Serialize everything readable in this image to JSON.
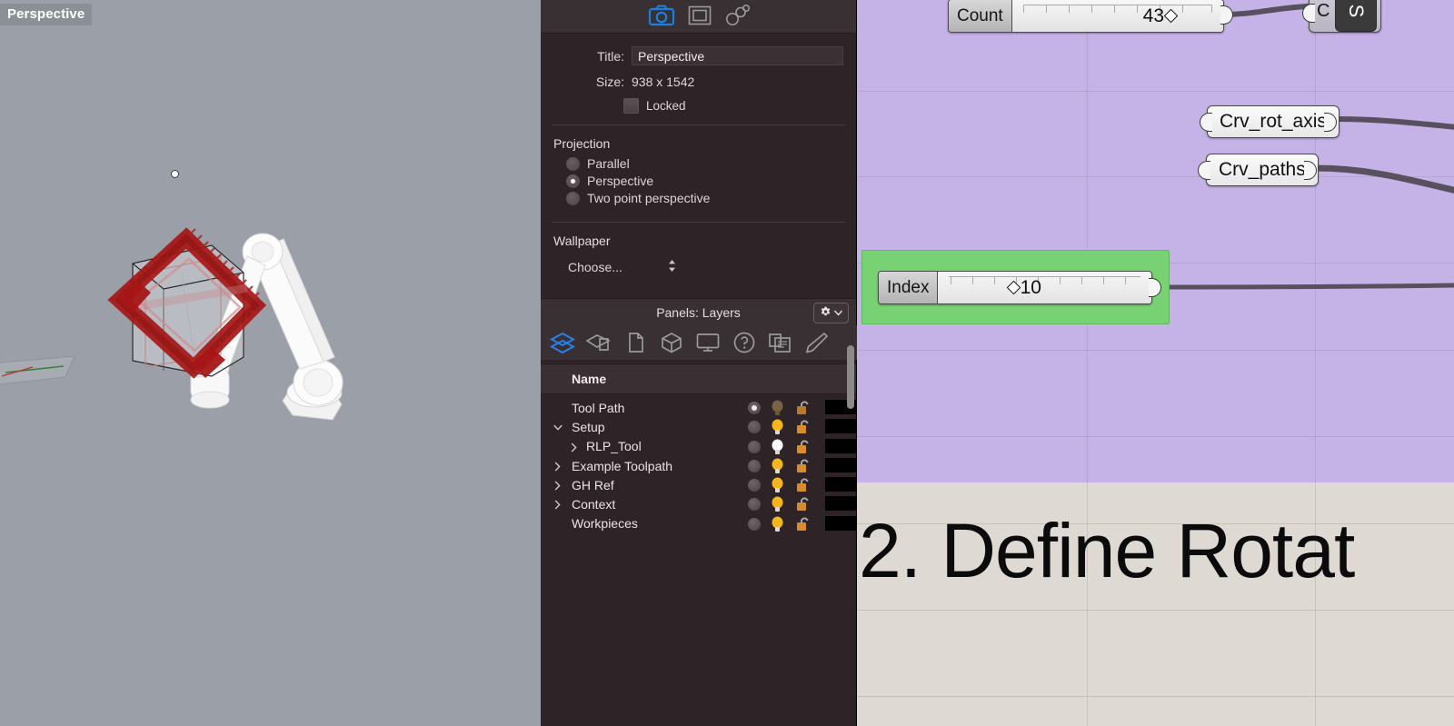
{
  "viewport": {
    "label": "Perspective",
    "background_color": "#9ba0a8",
    "scene_description": "White 6-axis robot arm with red toolpath curves around a transparent box workpiece"
  },
  "properties_panel": {
    "top_toolbar_icons": [
      "camera-icon",
      "viewport-frame-icon",
      "link-icon"
    ],
    "title_label": "Title:",
    "title_value": "Perspective",
    "size_label": "Size:",
    "size_value": "938 x 1542",
    "locked_label": "Locked",
    "locked_checked": false,
    "projection": {
      "heading": "Projection",
      "options": [
        {
          "label": "Parallel",
          "selected": false
        },
        {
          "label": "Perspective",
          "selected": true
        },
        {
          "label": "Two point perspective",
          "selected": false
        }
      ]
    },
    "wallpaper": {
      "heading": "Wallpaper",
      "choose_label": "Choose...",
      "stepper_icon": "chevron-updown-icon"
    }
  },
  "panels": {
    "header_title": "Panels: Layers",
    "gear_button": {
      "icon": "gear-icon",
      "chevron": "chevron-down-icon"
    },
    "tab_icons": [
      {
        "name": "layers-icon",
        "active": true
      },
      {
        "name": "named-views-icon",
        "active": false
      },
      {
        "name": "page-icon",
        "active": false
      },
      {
        "name": "cube-icon",
        "active": false
      },
      {
        "name": "display-icon",
        "active": false
      },
      {
        "name": "help-icon",
        "active": false
      },
      {
        "name": "notes-icon",
        "active": false
      },
      {
        "name": "brush-icon",
        "active": false
      }
    ],
    "column_header": "Name",
    "layers": [
      {
        "name": "Tool Path",
        "indent": 0,
        "twisty": "",
        "on": true,
        "bulb": "off",
        "lock": "unlocked",
        "swatch": "#000000"
      },
      {
        "name": "Setup",
        "indent": 0,
        "twisty": "v",
        "on": false,
        "bulb": "on",
        "lock": "unlocked",
        "swatch": "#000000"
      },
      {
        "name": "RLP_Tool",
        "indent": 1,
        "twisty": ">",
        "on": false,
        "bulb": "white",
        "lock": "unlocked",
        "swatch": "#000000"
      },
      {
        "name": "Example Toolpath",
        "indent": 0,
        "twisty": ">",
        "on": false,
        "bulb": "on",
        "lock": "unlocked",
        "swatch": "#000000"
      },
      {
        "name": "GH Ref",
        "indent": 0,
        "twisty": ">",
        "on": false,
        "bulb": "on",
        "lock": "unlocked",
        "swatch": "#000000"
      },
      {
        "name": "Context",
        "indent": 0,
        "twisty": ">",
        "on": false,
        "bulb": "on",
        "lock": "unlocked",
        "swatch": "#000000"
      },
      {
        "name": "Workpieces",
        "indent": 0,
        "twisty": "",
        "on": false,
        "bulb": "on",
        "lock": "unlocked",
        "swatch": "#000000"
      }
    ]
  },
  "grasshopper": {
    "group_purple_color": "#c5b3e8",
    "group_green_color": "#78d273",
    "canvas_background": "#dedad3",
    "section_title": "2. Define Rotat",
    "sliders": [
      {
        "name": "Count",
        "value": "43",
        "handle": "diamond"
      },
      {
        "name": "Index",
        "value": "10",
        "handle": "diamond"
      }
    ],
    "params": [
      {
        "name": "Crv_rot_axis"
      },
      {
        "name": "Crv_paths"
      }
    ],
    "component": {
      "input_label": "C",
      "body_label": "S"
    }
  }
}
